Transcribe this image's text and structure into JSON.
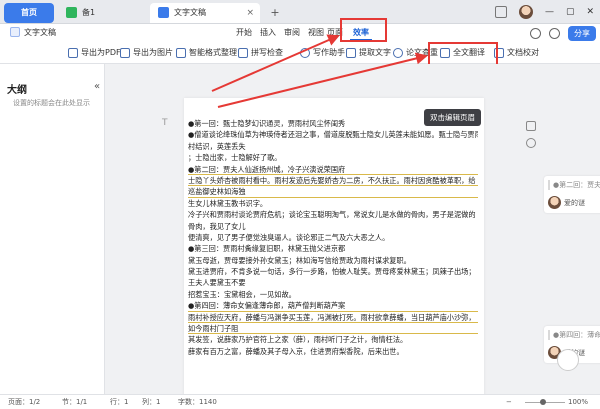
{
  "tabs": {
    "home_label": "首页",
    "tab1_label": "备1",
    "tab2_label": "文字文稿",
    "close_glyph": "×",
    "plus_glyph": "+"
  },
  "menu": {
    "doc_title": "文字文稿",
    "items": [
      "开始",
      "插入",
      "审阅",
      "视图",
      "页面",
      "效率"
    ],
    "share_label": "分享"
  },
  "toolbar": {
    "items": [
      "导出为PDF",
      "导出为图片",
      "智能格式整理",
      "拼写检查",
      "写作助手",
      "提取文字",
      "论文查重",
      "全文翻译",
      "文档校对"
    ]
  },
  "sidebar": {
    "title": "大纲",
    "hint": "设置的标题会在此处显示"
  },
  "document": {
    "tooltip": "双击编辑页眉",
    "lines": [
      "●第一回：甄士隐梦幻识通灵，贾雨村风尘怀闺秀",
      "●僧道谈论绛珠仙草为神瑛侍者还泪之事，僧道度脱甄士隐女儿英莲未能如愿。甄士隐与贾雨",
      "村结识，英莲丢失",
      "；士隐出家，士隐解好了歌。",
      "●第二回：贾夫人仙逝扬州城，冷子兴演说荣国府",
      "士隐丫头娇杏被雨村看中。雨村发迹后先娶娇杏为二房，不久扶正。雨村因贪酷被革职，给",
      "巡盐御史林如海独",
      "生女儿林黛玉教书识字。",
      "冷子兴和贾雨村谈论贾府危机；谈论宝玉聪明淘气，常说女儿是水做的骨肉，男子是泥做的",
      "骨肉，我见了女儿",
      "便清爽，见了男子便觉浊臭逼人。谈论邪正二气及六大恶之人。",
      "●第三回：贾雨村夤缘复旧职，林黛玉抛父进京都",
      "黛玉母逝，贾母要接外孙女黛玉；林如海写信给贾政为雨村谋求复职。",
      "黛玉进贾府，不肯多说一句话，多行一步路，怕被人耻笑。贾母疼爱林黛玉；凤辣子出场；",
      "王夫人要黛玉不要",
      "招惹宝玉：宝黛相会，一见如故。",
      "●第四回：薄命女偏逢薄命郎，葫芦僧判断葫芦案",
      "雨村补授应天府，薛蟠与冯渊争买玉莲，冯渊被打死。雨村欲拿薛蟠，当日葫芦庙小沙弥，",
      "如今雨村门子阻",
      "其发签，说薛家乃护官符上之家（薛），雨村听门子之计，徇情枉法。",
      "薛家有百万之富，薛蟠及其子母入京，住进贾府梨香院，后来出世。"
    ]
  },
  "comments": [
    {
      "ref": "●第二回：贾夫",
      "user": "爱的谜"
    },
    {
      "ref": "●第四回：薄命",
      "user": "爱的谜"
    }
  ],
  "status": {
    "page": "页面：1/2",
    "section": "节：1/1",
    "row": "行：1",
    "col": "列：1",
    "words": "字数：1140",
    "zoom": "100%"
  },
  "colors": {
    "accent": "#3b7bea",
    "highlight": "#e53935",
    "underline": "#d9b94a"
  }
}
